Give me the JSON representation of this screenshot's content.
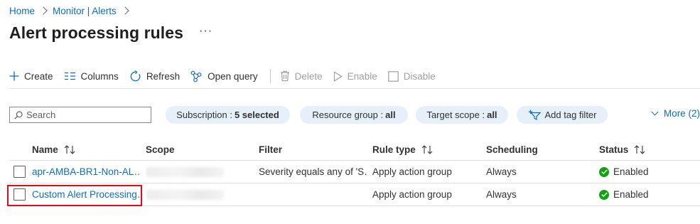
{
  "breadcrumb": {
    "items": [
      "Home",
      "Monitor | Alerts"
    ]
  },
  "page": {
    "title": "Alert processing rules",
    "more": "···"
  },
  "toolbar": {
    "create": "Create",
    "columns": "Columns",
    "refresh": "Refresh",
    "open_query": "Open query",
    "delete": "Delete",
    "enable": "Enable",
    "disable": "Disable"
  },
  "filters": {
    "search_placeholder": "Search",
    "subscription_label": "Subscription :",
    "subscription_value": "5 selected",
    "resource_group_label": "Resource group :",
    "resource_group_value": "all",
    "target_scope_label": "Target scope :",
    "target_scope_value": "all",
    "add_tag_filter": "Add tag filter",
    "more": "More (2)"
  },
  "table": {
    "columns": [
      "Name",
      "Scope",
      "Filter",
      "Rule type",
      "Scheduling",
      "Status"
    ],
    "rows": [
      {
        "name": "apr-AMBA-BR1-Non-AL…",
        "filter": "Severity equals any of 'S…",
        "rule_type": "Apply action group",
        "scheduling": "Always",
        "status": "Enabled"
      },
      {
        "name": "Custom Alert Processing…",
        "filter": "",
        "rule_type": "Apply action group",
        "scheduling": "Always",
        "status": "Enabled"
      }
    ]
  },
  "colors": {
    "link": "#0f6cbd",
    "pill_bg": "#e5f0fa",
    "status_ok": "#13a10e",
    "highlight": "#e00b1c"
  }
}
